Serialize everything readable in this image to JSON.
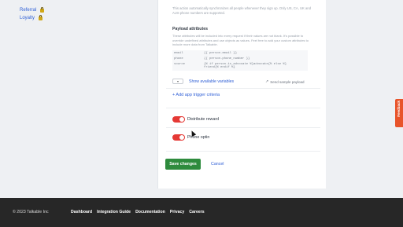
{
  "sidebar": {
    "items": [
      {
        "label": "Referral",
        "icon": "lock-icon"
      },
      {
        "label": "Loyalty",
        "icon": "lock-icon"
      }
    ]
  },
  "main": {
    "note": "This action automatically synchronizes all people whenever they sign up. Only US, CA, UK and AUS phone numbers are supported.",
    "payload": {
      "title": "Payload attributes",
      "description": "These attributes will be included into every request if their values are not blank. It's possible to override undefined attributes and use objects as values. Feel free to add your custom attributes to include more data from Talkable.",
      "rows": [
        {
          "key": "email",
          "value": "{{ person.email }}"
        },
        {
          "key": "phone",
          "value": "{{ person.phone_number }}"
        },
        {
          "key": "source",
          "value": "{% if person.is_advocate %}advocate{% else %}",
          "value2": "friend{% endif %}"
        }
      ]
    },
    "select_value": "▾",
    "show_variables": "Show available variables",
    "send_sample": "Send sample payload",
    "add_trigger": "+ Add app trigger criteria",
    "toggles": [
      {
        "label": "Distribute reward",
        "state": "on"
      },
      {
        "label": "Phone optin",
        "state": "on"
      }
    ],
    "save_label": "Save changes",
    "cancel_label": "Cancel"
  },
  "feedback_label": "Feedback",
  "footer": {
    "copyright": "© 2023 Talkable Inc",
    "links": [
      "Dashboard",
      "Integration Guide",
      "Documentation",
      "Privacy",
      "Careers"
    ]
  },
  "colors": {
    "accent": "#2f5fd6",
    "save": "#2e8b3d",
    "toggle": "#e53935",
    "feedback": "#e8542a",
    "footer": "#272727"
  }
}
